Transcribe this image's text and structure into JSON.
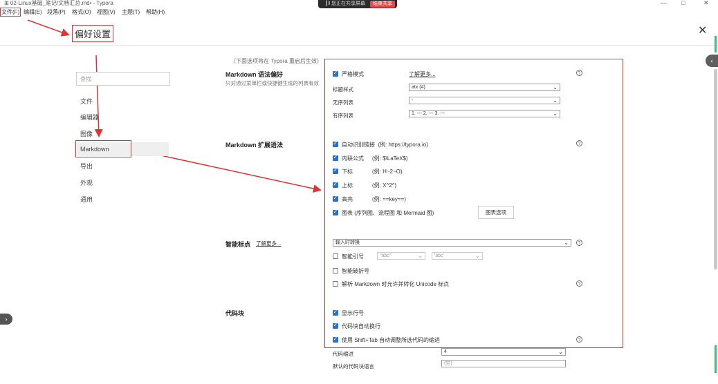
{
  "window": {
    "title": "⊞  02-Linux基础_笔记/文档汇总.md• - Typora",
    "recording_text": "┃‖ 您正在共享屏幕",
    "recording_stop": "结束共享",
    "controls": [
      "—",
      "□",
      "✕"
    ]
  },
  "menu": [
    "文件(F)",
    "编辑(E)",
    "段落(P)",
    "格式(O)",
    "视图(V)",
    "主题(T)",
    "帮助(H)"
  ],
  "dialog": {
    "title": "偏好设置",
    "close": "✕"
  },
  "sidebar": {
    "search_placeholder": "查找",
    "items": [
      "文件",
      "编辑器",
      "图像",
      "Markdown",
      "导出",
      "外观",
      "通用"
    ],
    "active": "Markdown"
  },
  "note": "（下面选项将在 Typora 重启后生效）",
  "markdown_prefs": {
    "title": "Markdown 语法偏好",
    "desc": "只对通过菜单栏或快捷键生成的列表有效",
    "strict_mode": "严格模式",
    "learn_more": "了解更多...",
    "heading_style_label": "标题样式",
    "heading_style_value": "atx (#)",
    "unordered_label": "无序列表",
    "unordered_value": "-",
    "ordered_label": "有序列表",
    "ordered_value": "1. --- 2. --- 3. ---"
  },
  "markdown_ext": {
    "title": "Markdown 扩展语法",
    "items": [
      {
        "label": "自动识别链接",
        "example": "(例: https://typora.io)",
        "checked": true
      },
      {
        "label": "内联公式",
        "example": "(例:  $\\LaTeX$)",
        "checked": true
      },
      {
        "label": "下标",
        "example": "(例:  H~2~O)",
        "checked": true
      },
      {
        "label": "上标",
        "example": "(例:  X^2^)",
        "checked": true
      },
      {
        "label": "高亮",
        "example": "(例:  ==key==)",
        "checked": true
      },
      {
        "label": "图表 (序列图、流程图 和 Mermaid 图)",
        "example": "",
        "checked": true
      }
    ],
    "chart_button": "图表选项"
  },
  "smart_punct": {
    "title": "智能标点",
    "learn_more": "了解更多...",
    "mode_value": "输入时转换",
    "smart_quotes": "智能引号",
    "quote_double": "\"abc\"",
    "quote_single": "'abc'",
    "smart_dash": "智能破折号",
    "unicode": "解析 Markdown 时允许并转化 Unicode 标点"
  },
  "code_block": {
    "title": "代码块",
    "line_numbers": "显示行号",
    "wrap": "代码块自动换行",
    "shift_tab": "使用 Shift+Tab 自动调整所选代码的缩进",
    "indent_label": "代码缩进",
    "indent_value": "4",
    "default_lang_label": "默认的代码块语言",
    "default_lang_placeholder": "(空)"
  },
  "icons": {
    "help": "?",
    "chevron": "⌄",
    "side_left": "‹",
    "side_right": "›"
  }
}
